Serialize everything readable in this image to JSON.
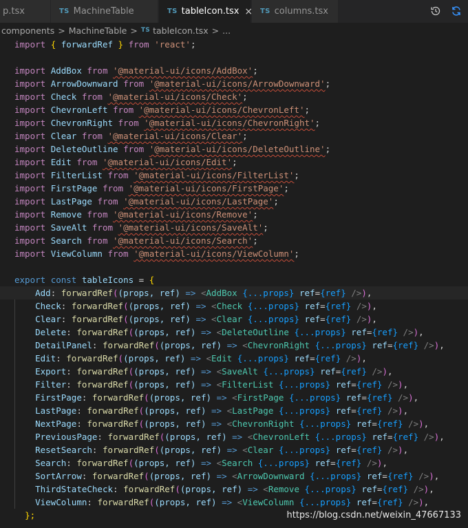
{
  "tabs": [
    {
      "label": "p.tsx",
      "badge": "",
      "active": false
    },
    {
      "label": "MachineTable",
      "badge": "TS",
      "active": false
    },
    {
      "label": "tableIcon.tsx",
      "badge": "TS",
      "active": true,
      "close": "×"
    },
    {
      "label": "columns.tsx",
      "badge": "TS",
      "active": false
    }
  ],
  "toolbar": {
    "history_icon": "history-icon",
    "sync_icon": "sync-icon"
  },
  "breadcrumb": {
    "items": [
      "components",
      "MachineTable",
      "tableIcon.tsx",
      "..."
    ],
    "badge": "TS",
    "separator": ">"
  },
  "code": {
    "react_import": {
      "kw": "import",
      "name": "forwardRef",
      "from": "from",
      "module": "'react'"
    },
    "imports": [
      {
        "name": "AddBox",
        "module": "'@material-ui/icons/AddBox'"
      },
      {
        "name": "ArrowDownward",
        "module": "'@material-ui/icons/ArrowDownward'"
      },
      {
        "name": "Check",
        "module": "'@material-ui/icons/Check'"
      },
      {
        "name": "ChevronLeft",
        "module": "'@material-ui/icons/ChevronLeft'"
      },
      {
        "name": "ChevronRight",
        "module": "'@material-ui/icons/ChevronRight'"
      },
      {
        "name": "Clear",
        "module": "'@material-ui/icons/Clear'"
      },
      {
        "name": "DeleteOutline",
        "module": "'@material-ui/icons/DeleteOutline'"
      },
      {
        "name": "Edit",
        "module": "'@material-ui/icons/Edit'"
      },
      {
        "name": "FilterList",
        "module": "'@material-ui/icons/FilterList'"
      },
      {
        "name": "FirstPage",
        "module": "'@material-ui/icons/FirstPage'"
      },
      {
        "name": "LastPage",
        "module": "'@material-ui/icons/LastPage'"
      },
      {
        "name": "Remove",
        "module": "'@material-ui/icons/Remove'"
      },
      {
        "name": "SaveAlt",
        "module": "'@material-ui/icons/SaveAlt'"
      },
      {
        "name": "Search",
        "module": "'@material-ui/icons/Search'"
      },
      {
        "name": "ViewColumn",
        "module": "'@material-ui/icons/ViewColumn'"
      }
    ],
    "export_line": {
      "export": "export",
      "const": "const",
      "name": "tableIcons"
    },
    "entries": [
      {
        "key": "Add",
        "component": "AddBox"
      },
      {
        "key": "Check",
        "component": "Check"
      },
      {
        "key": "Clear",
        "component": "Clear"
      },
      {
        "key": "Delete",
        "component": "DeleteOutline"
      },
      {
        "key": "DetailPanel",
        "component": "ChevronRight"
      },
      {
        "key": "Edit",
        "component": "Edit"
      },
      {
        "key": "Export",
        "component": "SaveAlt"
      },
      {
        "key": "Filter",
        "component": "FilterList"
      },
      {
        "key": "FirstPage",
        "component": "FirstPage"
      },
      {
        "key": "LastPage",
        "component": "LastPage"
      },
      {
        "key": "NextPage",
        "component": "ChevronRight"
      },
      {
        "key": "PreviousPage",
        "component": "ChevronLeft"
      },
      {
        "key": "ResetSearch",
        "component": "Clear"
      },
      {
        "key": "Search",
        "component": "Search"
      },
      {
        "key": "SortArrow",
        "component": "ArrowDownward"
      },
      {
        "key": "ThirdStateCheck",
        "component": "Remove"
      },
      {
        "key": "ViewColumn",
        "component": "ViewColumn"
      }
    ],
    "entry_parts": {
      "fn": "forwardRef",
      "params": "(props, ref)",
      "arrow": "=>",
      "spread": "{...props}",
      "ref_attr": "ref",
      "ref_val": "{ref}",
      "close": "/>"
    },
    "closing": "};"
  },
  "watermark": "https://blog.csdn.net/weixin_47667133"
}
